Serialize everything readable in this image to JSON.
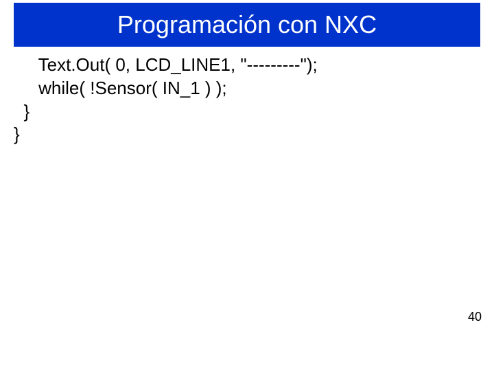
{
  "title": "Programación con NXC",
  "code": {
    "line1": "     Text.Out( 0, LCD_LINE1, \"---------\");",
    "line2": "     while( !Sensor( IN_1 ) );",
    "line3": "  }",
    "line4": "}"
  },
  "page_number": "40"
}
